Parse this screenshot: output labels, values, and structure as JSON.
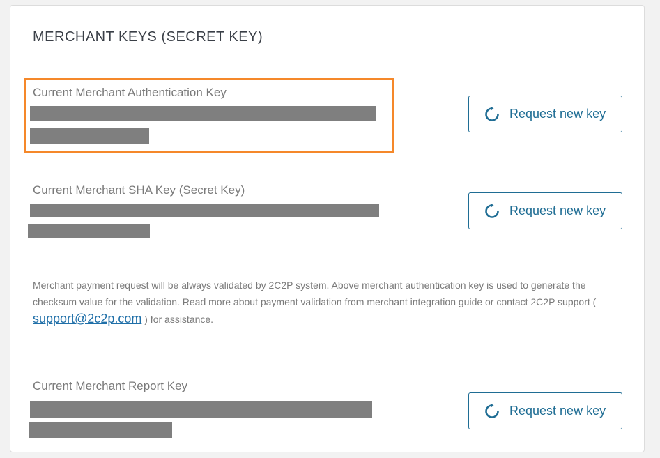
{
  "section": {
    "title": "MERCHANT KEYS (SECRET KEY)"
  },
  "keys": [
    {
      "label": "Current Merchant Authentication Key",
      "button_label": "Request new key"
    },
    {
      "label": "Current Merchant SHA Key (Secret Key)",
      "button_label": "Request new key"
    },
    {
      "label": "Current Merchant Report Key",
      "button_label": "Request new key"
    }
  ],
  "note": {
    "text_before": "Merchant payment request will be always validated by 2C2P system. Above merchant authentication key is used to generate the checksum value for the validation. Read more about payment validation from merchant integration guide or contact 2C2P support ( ",
    "email": "support@2c2p.com",
    "text_after": " ) for assistance."
  },
  "icons": {
    "request_key": "refresh-icon"
  },
  "colors": {
    "accent": "#1f6d94",
    "highlight": "#f5882a",
    "redaction": "#7f7f7f"
  }
}
